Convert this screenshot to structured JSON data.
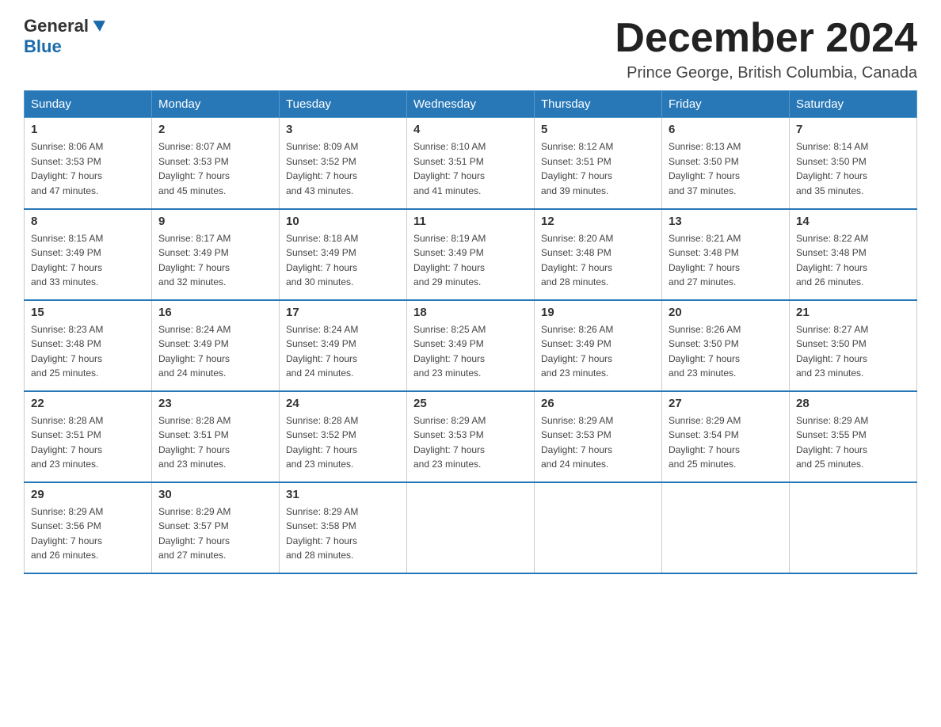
{
  "logo": {
    "text_general": "General",
    "text_blue": "Blue",
    "arrow_color": "#1a6aab"
  },
  "header": {
    "month_year": "December 2024",
    "location": "Prince George, British Columbia, Canada"
  },
  "weekdays": [
    "Sunday",
    "Monday",
    "Tuesday",
    "Wednesday",
    "Thursday",
    "Friday",
    "Saturday"
  ],
  "weeks": [
    [
      {
        "day": "1",
        "sunrise": "8:06 AM",
        "sunset": "3:53 PM",
        "daylight": "7 hours and 47 minutes."
      },
      {
        "day": "2",
        "sunrise": "8:07 AM",
        "sunset": "3:53 PM",
        "daylight": "7 hours and 45 minutes."
      },
      {
        "day": "3",
        "sunrise": "8:09 AM",
        "sunset": "3:52 PM",
        "daylight": "7 hours and 43 minutes."
      },
      {
        "day": "4",
        "sunrise": "8:10 AM",
        "sunset": "3:51 PM",
        "daylight": "7 hours and 41 minutes."
      },
      {
        "day": "5",
        "sunrise": "8:12 AM",
        "sunset": "3:51 PM",
        "daylight": "7 hours and 39 minutes."
      },
      {
        "day": "6",
        "sunrise": "8:13 AM",
        "sunset": "3:50 PM",
        "daylight": "7 hours and 37 minutes."
      },
      {
        "day": "7",
        "sunrise": "8:14 AM",
        "sunset": "3:50 PM",
        "daylight": "7 hours and 35 minutes."
      }
    ],
    [
      {
        "day": "8",
        "sunrise": "8:15 AM",
        "sunset": "3:49 PM",
        "daylight": "7 hours and 33 minutes."
      },
      {
        "day": "9",
        "sunrise": "8:17 AM",
        "sunset": "3:49 PM",
        "daylight": "7 hours and 32 minutes."
      },
      {
        "day": "10",
        "sunrise": "8:18 AM",
        "sunset": "3:49 PM",
        "daylight": "7 hours and 30 minutes."
      },
      {
        "day": "11",
        "sunrise": "8:19 AM",
        "sunset": "3:49 PM",
        "daylight": "7 hours and 29 minutes."
      },
      {
        "day": "12",
        "sunrise": "8:20 AM",
        "sunset": "3:48 PM",
        "daylight": "7 hours and 28 minutes."
      },
      {
        "day": "13",
        "sunrise": "8:21 AM",
        "sunset": "3:48 PM",
        "daylight": "7 hours and 27 minutes."
      },
      {
        "day": "14",
        "sunrise": "8:22 AM",
        "sunset": "3:48 PM",
        "daylight": "7 hours and 26 minutes."
      }
    ],
    [
      {
        "day": "15",
        "sunrise": "8:23 AM",
        "sunset": "3:48 PM",
        "daylight": "7 hours and 25 minutes."
      },
      {
        "day": "16",
        "sunrise": "8:24 AM",
        "sunset": "3:49 PM",
        "daylight": "7 hours and 24 minutes."
      },
      {
        "day": "17",
        "sunrise": "8:24 AM",
        "sunset": "3:49 PM",
        "daylight": "7 hours and 24 minutes."
      },
      {
        "day": "18",
        "sunrise": "8:25 AM",
        "sunset": "3:49 PM",
        "daylight": "7 hours and 23 minutes."
      },
      {
        "day": "19",
        "sunrise": "8:26 AM",
        "sunset": "3:49 PM",
        "daylight": "7 hours and 23 minutes."
      },
      {
        "day": "20",
        "sunrise": "8:26 AM",
        "sunset": "3:50 PM",
        "daylight": "7 hours and 23 minutes."
      },
      {
        "day": "21",
        "sunrise": "8:27 AM",
        "sunset": "3:50 PM",
        "daylight": "7 hours and 23 minutes."
      }
    ],
    [
      {
        "day": "22",
        "sunrise": "8:28 AM",
        "sunset": "3:51 PM",
        "daylight": "7 hours and 23 minutes."
      },
      {
        "day": "23",
        "sunrise": "8:28 AM",
        "sunset": "3:51 PM",
        "daylight": "7 hours and 23 minutes."
      },
      {
        "day": "24",
        "sunrise": "8:28 AM",
        "sunset": "3:52 PM",
        "daylight": "7 hours and 23 minutes."
      },
      {
        "day": "25",
        "sunrise": "8:29 AM",
        "sunset": "3:53 PM",
        "daylight": "7 hours and 23 minutes."
      },
      {
        "day": "26",
        "sunrise": "8:29 AM",
        "sunset": "3:53 PM",
        "daylight": "7 hours and 24 minutes."
      },
      {
        "day": "27",
        "sunrise": "8:29 AM",
        "sunset": "3:54 PM",
        "daylight": "7 hours and 25 minutes."
      },
      {
        "day": "28",
        "sunrise": "8:29 AM",
        "sunset": "3:55 PM",
        "daylight": "7 hours and 25 minutes."
      }
    ],
    [
      {
        "day": "29",
        "sunrise": "8:29 AM",
        "sunset": "3:56 PM",
        "daylight": "7 hours and 26 minutes."
      },
      {
        "day": "30",
        "sunrise": "8:29 AM",
        "sunset": "3:57 PM",
        "daylight": "7 hours and 27 minutes."
      },
      {
        "day": "31",
        "sunrise": "8:29 AM",
        "sunset": "3:58 PM",
        "daylight": "7 hours and 28 minutes."
      },
      null,
      null,
      null,
      null
    ]
  ],
  "labels": {
    "sunrise": "Sunrise:",
    "sunset": "Sunset:",
    "daylight": "Daylight:"
  }
}
